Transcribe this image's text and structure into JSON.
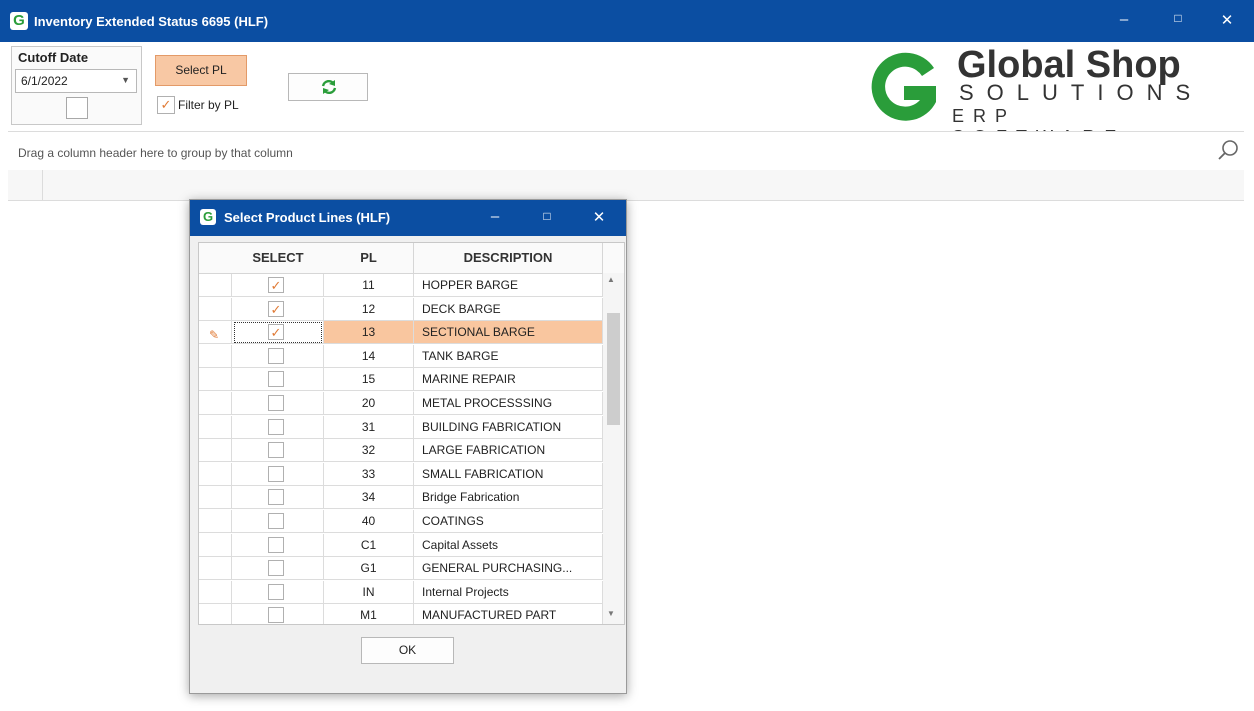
{
  "window": {
    "icon_letter": "G",
    "title": "Inventory Extended Status 6695 (HLF)",
    "minimize": "–",
    "maximize": "□",
    "close": "✕"
  },
  "toolbar": {
    "cutoff_label": "Cutoff Date",
    "cutoff_value": "6/1/2022",
    "select_pl_label": "Select PL",
    "filter_by_pl_label": "Filter by PL",
    "filter_by_pl_checked": true
  },
  "logo": {
    "line1": "Global Shop",
    "line2": "SOLUTIONS",
    "line3": "ERP SOFTWARE"
  },
  "grid": {
    "group_panel_text": "Drag a column header here to group by that column"
  },
  "dialog": {
    "icon_letter": "G",
    "title": "Select Product Lines (HLF)",
    "minimize": "–",
    "maximize": "□",
    "close": "✕",
    "columns": [
      "SELECT",
      "PL",
      "DESCRIPTION"
    ],
    "rows": [
      {
        "pl": "11",
        "desc": "HOPPER  BARGE",
        "checked": true
      },
      {
        "pl": "12",
        "desc": "DECK BARGE",
        "checked": true
      },
      {
        "pl": "13",
        "desc": "SECTIONAL BARGE",
        "checked": true,
        "selected": true
      },
      {
        "pl": "14",
        "desc": "TANK BARGE",
        "checked": false
      },
      {
        "pl": "15",
        "desc": "MARINE REPAIR",
        "checked": false
      },
      {
        "pl": "20",
        "desc": "METAL PROCESSSING",
        "checked": false
      },
      {
        "pl": "31",
        "desc": "BUILDING FABRICATION",
        "checked": false
      },
      {
        "pl": "32",
        "desc": "LARGE FABRICATION",
        "checked": false
      },
      {
        "pl": "33",
        "desc": "SMALL FABRICATION",
        "checked": false
      },
      {
        "pl": "34",
        "desc": "Bridge Fabrication",
        "checked": false
      },
      {
        "pl": "40",
        "desc": "COATINGS",
        "checked": false
      },
      {
        "pl": "C1",
        "desc": "Capital Assets",
        "checked": false
      },
      {
        "pl": "G1",
        "desc": "GENERAL PURCHASING...",
        "checked": false
      },
      {
        "pl": "IN",
        "desc": "Internal Projects",
        "checked": false
      },
      {
        "pl": "M1",
        "desc": "MANUFACTURED PART",
        "checked": false
      }
    ],
    "ok_label": "OK"
  },
  "colors": {
    "titlebar": "#0b4ea2",
    "accent": "#f8c8a4",
    "selected_row": "#f9c69f",
    "check": "#e07a35",
    "logo_green": "#2a9d3a"
  }
}
